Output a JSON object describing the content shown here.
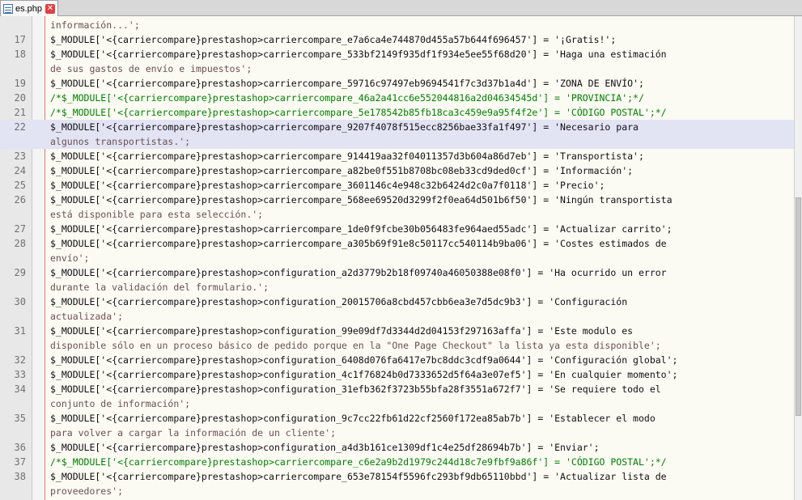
{
  "tab": {
    "label": "es.php"
  },
  "lines": [
    {
      "num": "",
      "text": "información...';",
      "type": "str",
      "hl": false
    },
    {
      "num": "17",
      "text": "$_MODULE['<{carriercompare}prestashop>carriercompare_e7a6ca4e744870d455a57b644f696457'] = '¡Gratis!';",
      "type": "code",
      "hl": false
    },
    {
      "num": "18",
      "text": "$_MODULE['<{carriercompare}prestashop>carriercompare_533bf2149f935df1f934e5ee55f68d20'] = 'Haga una estimación",
      "type": "code",
      "hl": false
    },
    {
      "num": "",
      "text": "de sus gastos de envío e impuestos';",
      "type": "str",
      "hl": false
    },
    {
      "num": "19",
      "text": "$_MODULE['<{carriercompare}prestashop>carriercompare_59716c97497eb9694541f7c3d37b1a4d'] = 'ZONA DE ENVÍO';",
      "type": "code",
      "hl": false
    },
    {
      "num": "20",
      "text": "/*$_MODULE['<{carriercompare}prestashop>carriercompare_46a2a41cc6e552044816a2d04634545d'] = 'PROVINCIA';*/",
      "type": "comment",
      "hl": false
    },
    {
      "num": "21",
      "text": "/*$_MODULE['<{carriercompare}prestashop>carriercompare_5e178542b85fb18ca3c459e9a95f4f2e'] = 'CÓDIGO POSTAL';*/",
      "type": "comment",
      "hl": false
    },
    {
      "num": "22",
      "text": "$_MODULE['<{carriercompare}prestashop>carriercompare_9207f4078f515ecc8256bae33fa1f497'] = 'Necesario para",
      "type": "code",
      "hl": true
    },
    {
      "num": "",
      "text": "algunos transportistas.';",
      "type": "str",
      "hl": true
    },
    {
      "num": "23",
      "text": "$_MODULE['<{carriercompare}prestashop>carriercompare_914419aa32f04011357d3b604a86d7eb'] = 'Transportista';",
      "type": "code",
      "hl": false
    },
    {
      "num": "24",
      "text": "$_MODULE['<{carriercompare}prestashop>carriercompare_a82be0f551b8708bc08eb33cd9ded0cf'] = 'Información';",
      "type": "code",
      "hl": false
    },
    {
      "num": "25",
      "text": "$_MODULE['<{carriercompare}prestashop>carriercompare_3601146c4e948c32b6424d2c0a7f0118'] = 'Precio';",
      "type": "code",
      "hl": false
    },
    {
      "num": "26",
      "text": "$_MODULE['<{carriercompare}prestashop>carriercompare_568ee69520d3299f2f0ea64d501b6f50'] = 'Ningún transportista",
      "type": "code",
      "hl": false
    },
    {
      "num": "",
      "text": "está disponible para esta selección.';",
      "type": "str",
      "hl": false
    },
    {
      "num": "27",
      "text": "$_MODULE['<{carriercompare}prestashop>carriercompare_1de0f9fcbe30b056483fe964aed55adc'] = 'Actualizar carrito';",
      "type": "code",
      "hl": false
    },
    {
      "num": "28",
      "text": "$_MODULE['<{carriercompare}prestashop>carriercompare_a305b69f91e8c50117cc540114b9ba06'] = 'Costes estimados de",
      "type": "code",
      "hl": false
    },
    {
      "num": "",
      "text": "envío';",
      "type": "str",
      "hl": false
    },
    {
      "num": "29",
      "text": "$_MODULE['<{carriercompare}prestashop>configuration_a2d3779b2b18f09740a46050388e08f0'] = 'Ha ocurrido un error",
      "type": "code",
      "hl": false
    },
    {
      "num": "",
      "text": "durante la validación del formulario.';",
      "type": "str",
      "hl": false
    },
    {
      "num": "30",
      "text": "$_MODULE['<{carriercompare}prestashop>configuration_20015706a8cbd457cbb6ea3e7d5dc9b3'] = 'Configuración",
      "type": "code",
      "hl": false
    },
    {
      "num": "",
      "text": "actualizada';",
      "type": "str",
      "hl": false
    },
    {
      "num": "31",
      "text": "$_MODULE['<{carriercompare}prestashop>configuration_99e09df7d3344d2d04153f297163affa'] = 'Este modulo es",
      "type": "code",
      "hl": false
    },
    {
      "num": "",
      "text": "disponible sólo en un proceso básico de pedido porque en la \"One Page Checkout\" la lista ya esta disponible';",
      "type": "str",
      "hl": false
    },
    {
      "num": "32",
      "text": "$_MODULE['<{carriercompare}prestashop>configuration_6408d076fa6417e7bc8ddc3cdf9a0644'] = 'Configuración global';",
      "type": "code",
      "hl": false
    },
    {
      "num": "33",
      "text": "$_MODULE['<{carriercompare}prestashop>configuration_4c1f76824b0d7333652d5f64a3e07ef5'] = 'En cualquier momento';",
      "type": "code",
      "hl": false
    },
    {
      "num": "34",
      "text": "$_MODULE['<{carriercompare}prestashop>configuration_31efb362f3723b55bfa28f3551a672f7'] = 'Se requiere todo el",
      "type": "code",
      "hl": false
    },
    {
      "num": "",
      "text": "conjunto de información';",
      "type": "str",
      "hl": false
    },
    {
      "num": "35",
      "text": "$_MODULE['<{carriercompare}prestashop>configuration_9c7cc22fb61d22cf2560f172ea85ab7b'] = 'Establecer el modo",
      "type": "code",
      "hl": false
    },
    {
      "num": "",
      "text": "para volver a cargar la información de un cliente';",
      "type": "str",
      "hl": false
    },
    {
      "num": "36",
      "text": "$_MODULE['<{carriercompare}prestashop>configuration_a4d3b161ce1309df1c4e25df28694b7b'] = 'Enviar';",
      "type": "code",
      "hl": false
    },
    {
      "num": "37",
      "text": "/*$_MODULE['<{carriercompare}prestashop>carriercompare_c6e2a9b2d1979c244d18c7e9fbf9a86f'] = 'CÓDIGO POSTAL';*/",
      "type": "comment",
      "hl": false
    },
    {
      "num": "38",
      "text": "$_MODULE['<{carriercompare}prestashop>carriercompare_653e78154f5596fc293bf9db65110bbd'] = 'Actualizar lista de",
      "type": "code",
      "hl": false
    },
    {
      "num": "",
      "text": "proveedores';",
      "type": "str",
      "hl": false
    }
  ]
}
